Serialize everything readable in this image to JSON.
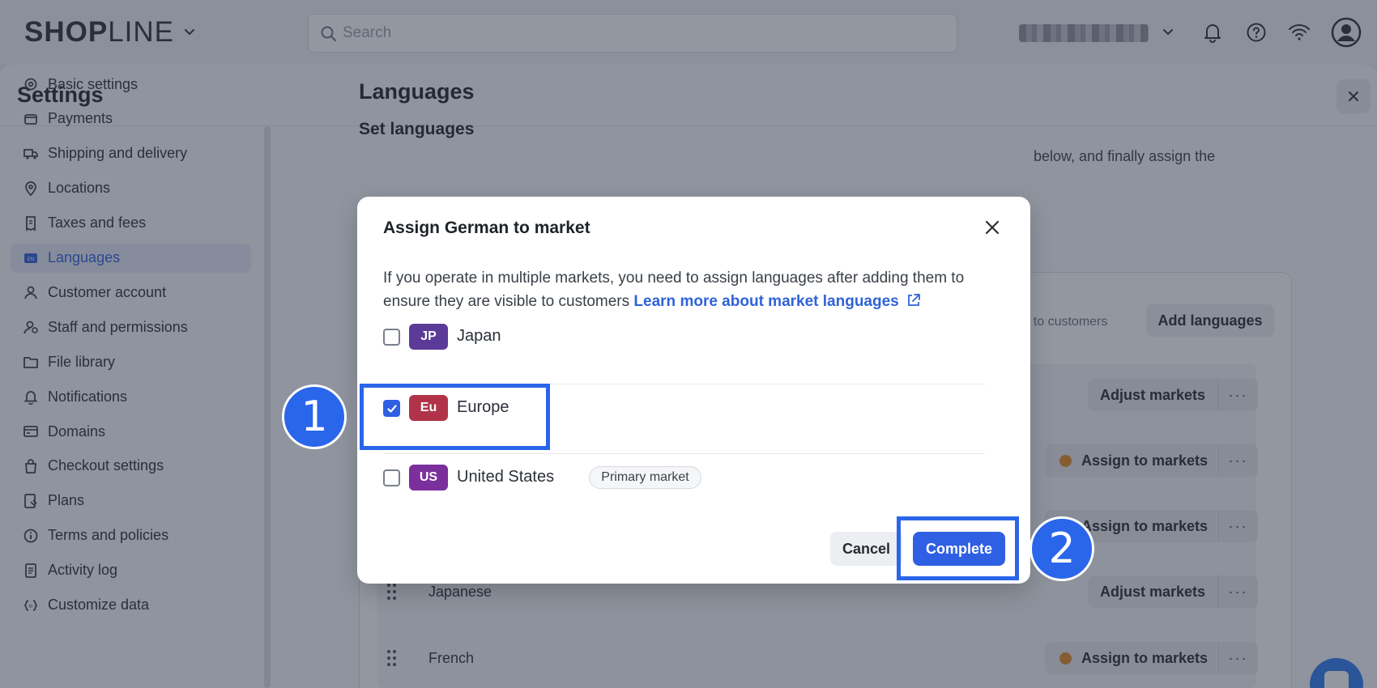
{
  "header": {
    "logo_bold": "SHOP",
    "logo_thin": "LINE",
    "search_placeholder": "Search",
    "icons": [
      "chevron-down-icon",
      "search-icon",
      "bell-icon",
      "help-icon",
      "wifi-icon",
      "user-avatar-icon"
    ]
  },
  "settings": {
    "title": "Settings",
    "sidebar": [
      {
        "label": "Basic settings",
        "icon": "gear-icon",
        "active": false
      },
      {
        "label": "Payments",
        "icon": "wallet-icon",
        "active": false
      },
      {
        "label": "Shipping and delivery",
        "icon": "truck-icon",
        "active": false
      },
      {
        "label": "Locations",
        "icon": "location-pin-icon",
        "active": false
      },
      {
        "label": "Taxes and fees",
        "icon": "receipt-icon",
        "active": false
      },
      {
        "label": "Languages",
        "icon": "language-icon",
        "active": true
      },
      {
        "label": "Customer account",
        "icon": "person-icon",
        "active": false
      },
      {
        "label": "Staff and permissions",
        "icon": "staff-icon",
        "active": false
      },
      {
        "label": "File library",
        "icon": "folder-icon",
        "active": false
      },
      {
        "label": "Notifications",
        "icon": "bell-icon",
        "active": false
      },
      {
        "label": "Domains",
        "icon": "domain-icon",
        "active": false
      },
      {
        "label": "Checkout settings",
        "icon": "shopping-bag-icon",
        "active": false
      },
      {
        "label": "Plans",
        "icon": "plan-icon",
        "active": false
      },
      {
        "label": "Terms and policies",
        "icon": "info-icon",
        "active": false
      },
      {
        "label": "Activity log",
        "icon": "log-icon",
        "active": false
      },
      {
        "label": "Customize data",
        "icon": "code-icon",
        "active": false
      }
    ]
  },
  "content": {
    "title": "Languages",
    "subtitle": "Set languages",
    "desc_visible": "below, and finally assign the",
    "card_hint": "ble to customers",
    "add_languages": "Add languages",
    "rows": [
      {
        "name": "",
        "action": "Adjust markets",
        "warning": false
      },
      {
        "name": "",
        "action": "Assign to markets",
        "warning": true
      },
      {
        "name": "",
        "action": "Assign to markets",
        "warning": true
      },
      {
        "name": "Japanese",
        "action": "Adjust markets",
        "warning": false
      },
      {
        "name": "French",
        "action": "Assign to markets",
        "warning": true
      }
    ],
    "more_label": "···"
  },
  "modal": {
    "title": "Assign German to market",
    "description": "If you operate in multiple markets, you need to assign languages after adding them to ensure they are visible to customers",
    "link": "Learn more about market languages",
    "markets": [
      {
        "code": "JP",
        "name": "Japan",
        "checked": false,
        "color": "#5b3a98",
        "tag": ""
      },
      {
        "code": "Eu",
        "name": "Europe",
        "checked": true,
        "color": "#b1334a",
        "tag": ""
      },
      {
        "code": "US",
        "name": "United States",
        "checked": false,
        "color": "#7a2f9c",
        "tag": "Primary market"
      }
    ],
    "cancel": "Cancel",
    "complete": "Complete"
  },
  "annotations": {
    "step1": "1",
    "step2": "2",
    "highlight_color": "#2a66ea"
  }
}
